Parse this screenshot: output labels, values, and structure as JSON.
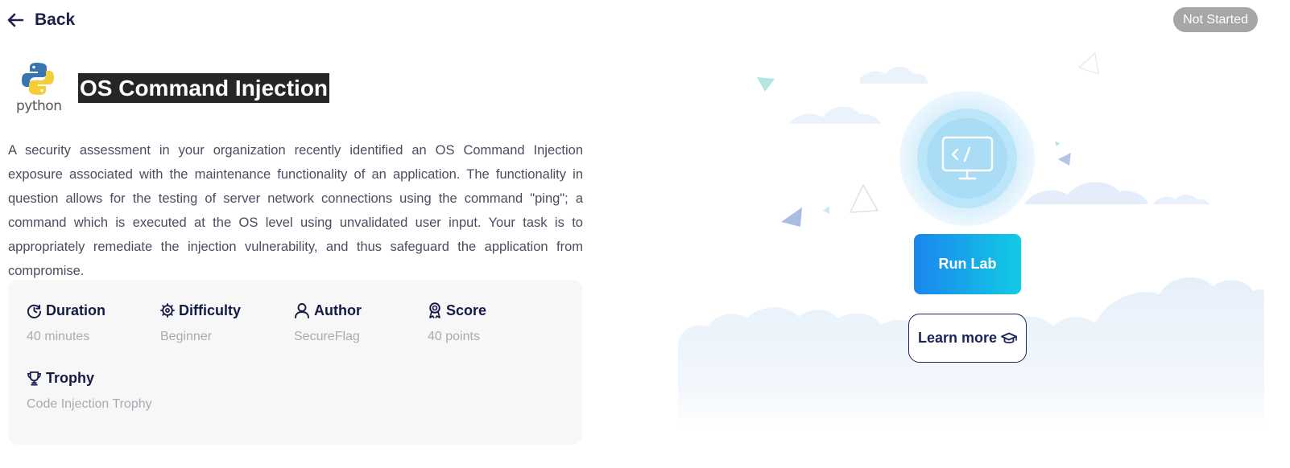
{
  "header": {
    "back_label": "Back",
    "back_icon": "arrow-left-icon",
    "status": "Not Started"
  },
  "lab": {
    "language_logo": "python-logo",
    "language_label": "python",
    "title": "OS Command Injection",
    "description": "A security assessment in your organization recently identified an OS Command Injection exposure associated with the maintenance functionality of an application. The functionality in question allows for the testing of server network connections using the command \"ping\"; a command which is executed at the OS level using unvalidated user input. Your task is to appropriately remediate the injection vulnerability, and thus safeguard the application from compromise."
  },
  "details": [
    {
      "label": "Duration",
      "value": "40 minutes",
      "icon": "clock-icon"
    },
    {
      "label": "Difficulty",
      "value": "Beginner",
      "icon": "gear-icon"
    },
    {
      "label": "Author",
      "value": "SecureFlag",
      "icon": "user-icon"
    },
    {
      "label": "Score",
      "value": "40 points",
      "icon": "award-icon"
    },
    {
      "label": "Trophy",
      "value": "Code Injection Trophy",
      "icon": "trophy-icon"
    }
  ],
  "actions": {
    "run_lab_label": "Run Lab",
    "learn_more_label": "Learn more",
    "learn_more_icon": "graduation-cap-icon"
  },
  "illustration": {
    "icon": "monitor-code-icon"
  },
  "colors": {
    "primary_text": "#1c1f4a",
    "muted_text": "#a9abb3",
    "badge_bg": "#a6a6a6",
    "run_gradient_start": "#1a86ee",
    "run_gradient_end": "#12cbe4",
    "card_bg": "#f7f7f8"
  }
}
